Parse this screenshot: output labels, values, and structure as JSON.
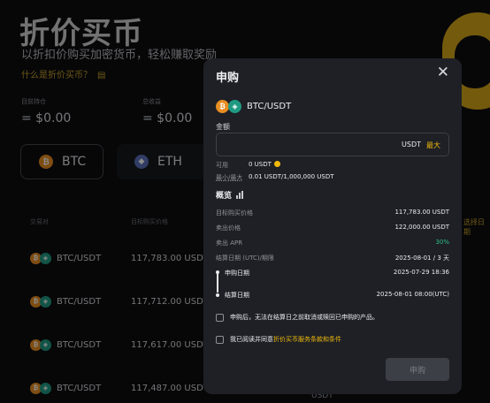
{
  "background": {
    "title": "折价买币",
    "subtitle": "以折扣价购买加密货币，轻松赚取奖励",
    "what_link": "什么是折价买币？",
    "stats": [
      {
        "label": "目前持仓",
        "value": "= $0.00"
      },
      {
        "label": "总收益",
        "value": "= $0.00"
      }
    ],
    "coin_tabs": [
      {
        "label": "BTC",
        "icon": "btc-coin-icon"
      },
      {
        "label": "ETH",
        "icon": "eth-coin-icon"
      }
    ],
    "columns": [
      "交易对",
      "目标购买价格"
    ],
    "right_link": "选择日期",
    "rows": [
      {
        "pair": "BTC/USDT",
        "price": "117,783.00 USDT"
      },
      {
        "pair": "BTC/USDT",
        "price": "117,712.00 USDT"
      },
      {
        "pair": "BTC/USDT",
        "price": "117,617.00 USDT"
      },
      {
        "pair": "BTC/USDT",
        "price": "117,487.00 USDT"
      }
    ],
    "bottom_unit": "USDT"
  },
  "modal": {
    "title": "申购",
    "pair": "BTC/USDT",
    "amount_label": "金额",
    "amount_value": "",
    "amount_unit": "USDT",
    "max_label": "最大",
    "available_label": "可用",
    "available_value": "0 USDT",
    "minmax_label": "最小/最大",
    "minmax_value": "0.01 USDT/1,000,000 USDT",
    "overview_label": "概览",
    "overview": [
      {
        "key": "目标购买价格",
        "value": "117,783.00 USDT"
      },
      {
        "key": "卖出价格",
        "value": "122,000.00 USDT"
      },
      {
        "key": "卖出 APR",
        "value": "30%"
      },
      {
        "key": "结算日期 (UTC)/期限",
        "value": "2025-08-01 / 3 天"
      }
    ],
    "timeline": [
      {
        "key": "申购日期",
        "value": "2025-07-29 18:36"
      },
      {
        "key": "结算日期",
        "value": "2025-08-01 08:00(UTC)"
      }
    ],
    "check_notice": "申购后，无法在结算日之前取消或赎回已申购的产品。",
    "agree_prefix": "我已阅读并同意",
    "agree_link": "折价买币服务条款和条件",
    "submit_label": "申购",
    "colors": {
      "accent": "#f0b90b",
      "positive": "#2ebd85",
      "panel": "#1e2026"
    }
  }
}
